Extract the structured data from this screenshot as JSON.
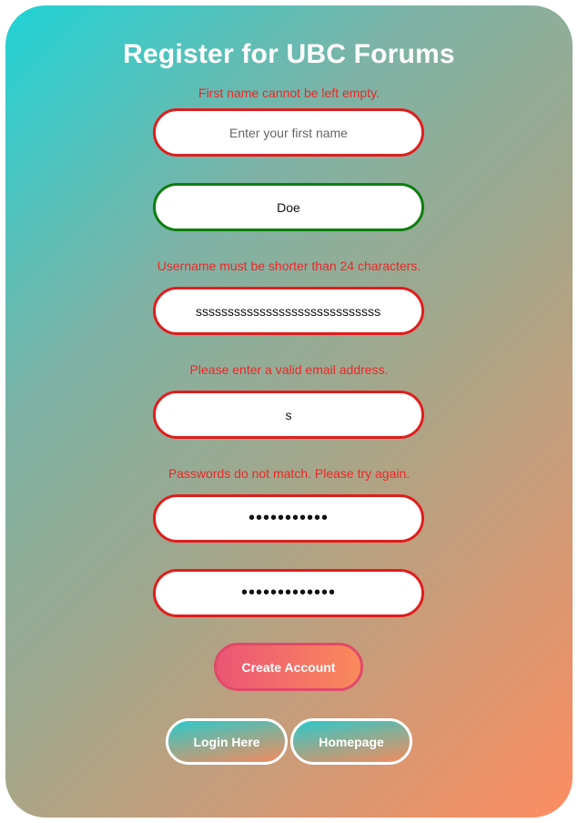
{
  "form": {
    "title": "Register for UBC Forums",
    "first_name": {
      "error": "First name cannot be left empty.",
      "placeholder": "Enter your first name",
      "value": ""
    },
    "last_name": {
      "value": "Doe"
    },
    "username": {
      "error": "Username must be shorter than 24 characters.",
      "value": "ssssssssssssssssssssssssssssssssss"
    },
    "email": {
      "error": "Please enter a valid email address.",
      "value": "s"
    },
    "password": {
      "error": "Passwords do not match. Please try again.",
      "masked": "•••••••••••"
    },
    "confirm_password": {
      "masked": "•••••••••••••"
    },
    "create_label": "Create Account",
    "login_label": "Login Here",
    "homepage_label": "Homepage"
  },
  "colors": {
    "error_text": "#ec2828",
    "error_border": "#e11d1d",
    "valid_border": "#0f7d0f",
    "gradient_start": "#20d3d6",
    "gradient_end": "#fd8c61"
  }
}
